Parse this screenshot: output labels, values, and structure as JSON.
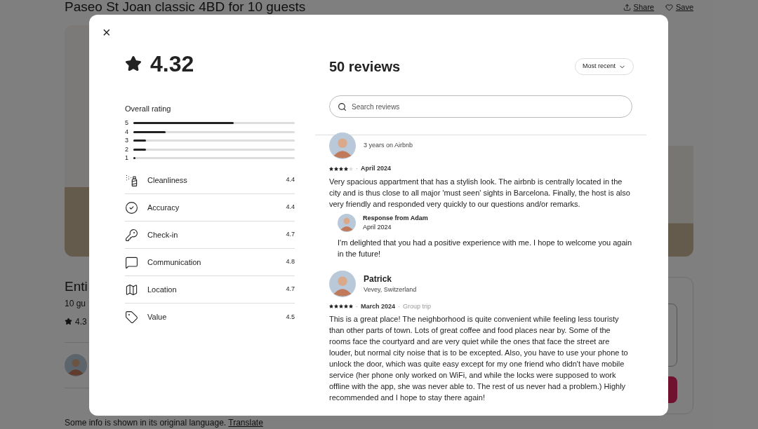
{
  "page": {
    "title": "Paseo St Joan classic 4BD for 10 guests",
    "actions": [
      "Share",
      "Save"
    ],
    "heading": "Enti",
    "subheading": "10 gu",
    "rating": "4.3",
    "notice": "Some info is shown in its original language.",
    "notice_link": "Translate"
  },
  "modal": {
    "close": "×",
    "separator": "·",
    "score": "4.32",
    "overall_label": "Overall rating",
    "distribution": [
      {
        "label": "5",
        "level": 0.62
      },
      {
        "label": "4",
        "level": 0.2
      },
      {
        "label": "3",
        "level": 0.08
      },
      {
        "label": "2",
        "level": 0.08
      },
      {
        "label": "1",
        "level": 0.015
      }
    ],
    "categories": [
      {
        "kind": "spray",
        "label": "Cleanliness",
        "value": "4.4"
      },
      {
        "kind": "check",
        "label": "Accuracy",
        "value": "4.4"
      },
      {
        "kind": "key",
        "label": "Check-in",
        "value": "4.7"
      },
      {
        "kind": "chat",
        "label": "Communication",
        "value": "4.8"
      },
      {
        "kind": "map",
        "label": "Location",
        "value": "4.7"
      },
      {
        "kind": "tag",
        "label": "Value",
        "value": "4.5"
      }
    ],
    "count": "50 reviews",
    "sort": "Most recent",
    "search": {
      "placeholder": "Search reviews"
    },
    "reviews": [
      {
        "meta": "3 years on Airbnb",
        "stars": 4,
        "date": "April 2024",
        "text": "Very spacious appartment that has a stylish look. The airbnb is centrally located in the city and is thus close to all major 'must seen' sights in Barcelona. Finally, the host is also very friendly and responded very quickly to our questions and/or remarks.",
        "response": {
          "title": "Response from Adam",
          "date": "April 2024",
          "text": "I'm delighted that you had a positive experience with me. I hope to welcome you again in the future!"
        }
      },
      {
        "name": "Patrick",
        "meta": "Vevey, Switzerland",
        "stars": 5,
        "date": "March 2024",
        "trip": "Group trip",
        "text": "This is a great place! The neighborhood is quite convenient while feeling less touristy than other parts of town. Lots of great coffee and food places near by. Some of the rooms face the courtyard and are very quiet while the ones that face the street are louder, but normal city noise that is to be excepted. Also, you have to use your phone to unlock the door, which was quite easy except for my one friend who didn't have mobile service (her phone only worked on WiFi, and while the locks were supposed to work offline with the app, she was never able to. The rest of us never had a problem.) Highly recommended and I hope to stay there again!"
      }
    ]
  }
}
